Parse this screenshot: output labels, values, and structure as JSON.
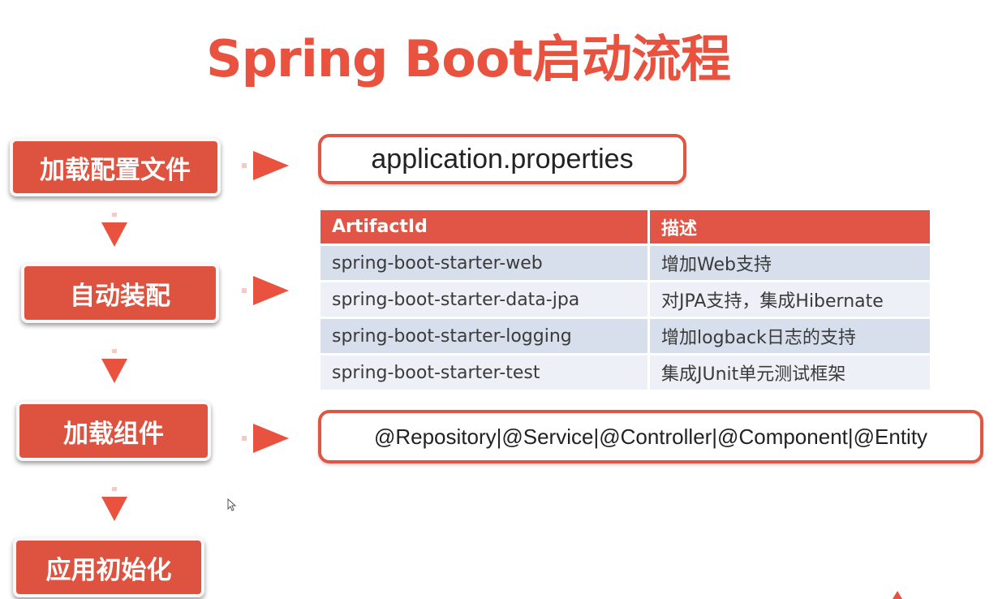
{
  "title": "Spring Boot启动流程",
  "steps": [
    {
      "label": "加载配置文件"
    },
    {
      "label": "自动装配"
    },
    {
      "label": "加载组件"
    },
    {
      "label": "应用初始化"
    }
  ],
  "config_box": {
    "text": "application.properties"
  },
  "starter_table": {
    "headers": [
      "ArtifactId",
      "描述"
    ],
    "rows": [
      [
        "spring-boot-starter-web",
        "增加Web支持"
      ],
      [
        "spring-boot-starter-data-jpa",
        "对JPA支持，集成Hibernate"
      ],
      [
        "spring-boot-starter-logging",
        "增加logback日志的支持"
      ],
      [
        "spring-boot-starter-test",
        "集成JUnit单元测试框架"
      ]
    ]
  },
  "components_box": {
    "text": "@Repository|@Service|@Controller|@Component|@Entity"
  },
  "colors": {
    "accent": "#de5240",
    "title": "#e8523e",
    "row_odd": "#d7dfec",
    "row_even": "#edf0f6"
  },
  "icons": [
    "down-arrow-icon",
    "right-arrow-icon",
    "cursor-icon"
  ]
}
